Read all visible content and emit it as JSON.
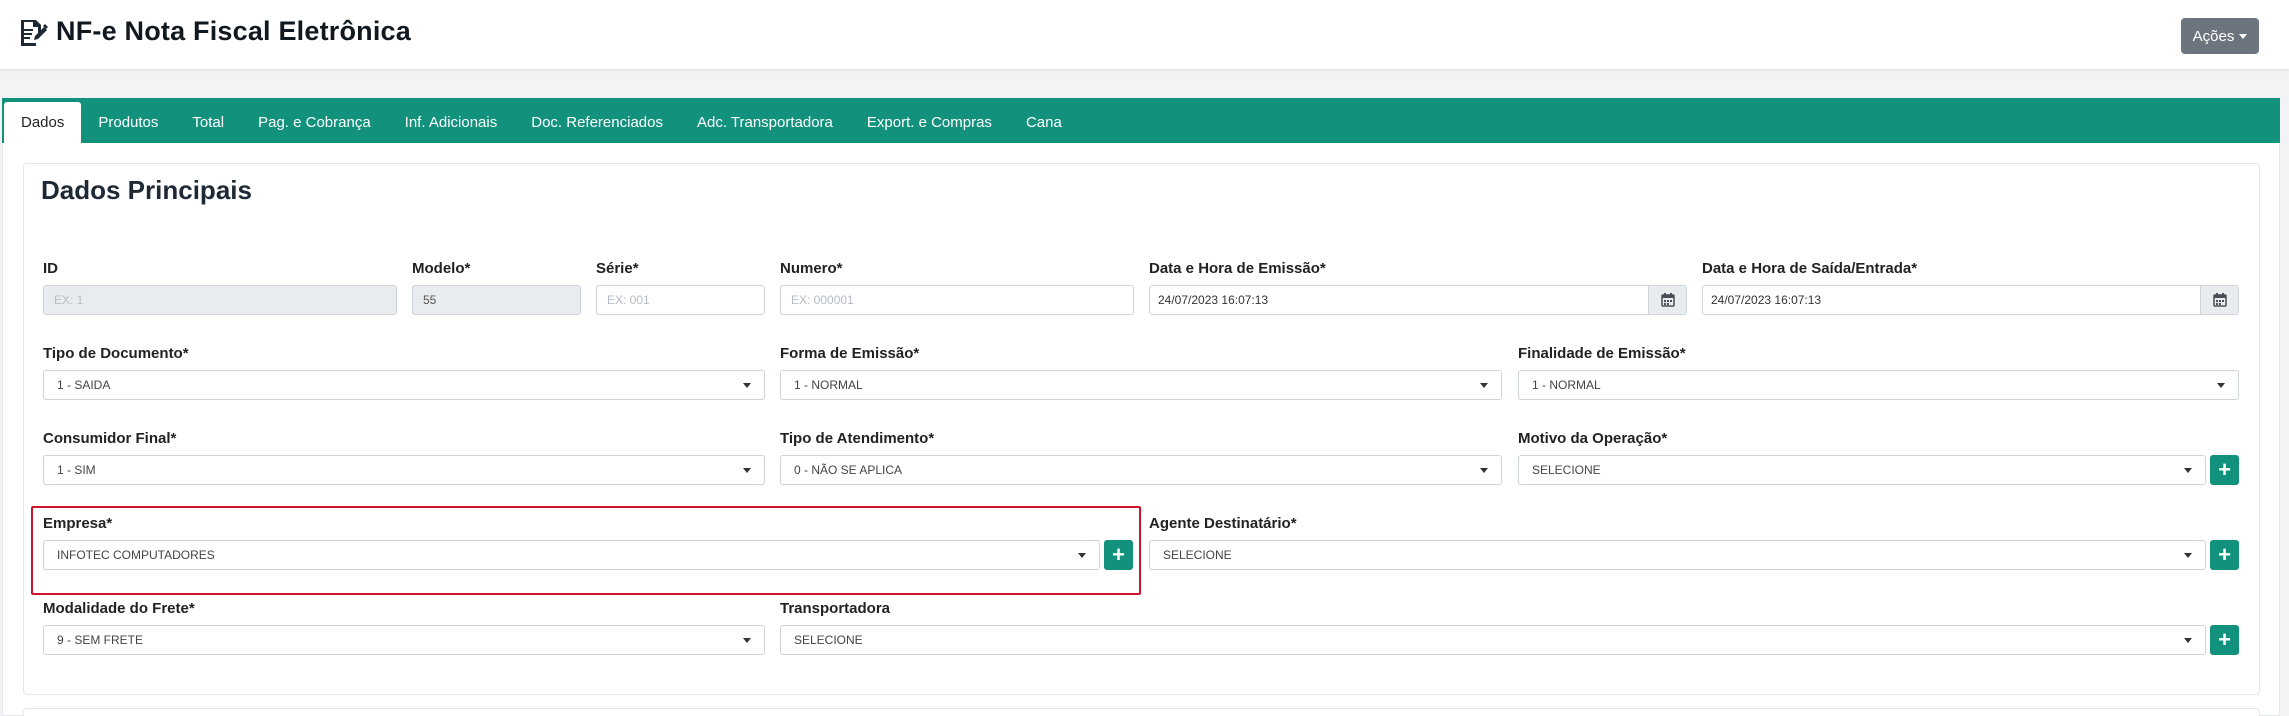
{
  "header": {
    "title": "NF-e Nota Fiscal Eletrônica",
    "title_icon": "document-edit-icon",
    "actions_label": "Ações"
  },
  "tabs": [
    {
      "label": "Dados",
      "active": true
    },
    {
      "label": "Produtos"
    },
    {
      "label": "Total"
    },
    {
      "label": "Pag. e Cobrança"
    },
    {
      "label": "Inf. Adicionais"
    },
    {
      "label": "Doc. Referenciados"
    },
    {
      "label": "Adc. Transportadora"
    },
    {
      "label": "Export. e Compras"
    },
    {
      "label": "Cana"
    }
  ],
  "section_title": "Dados Principais",
  "fields": {
    "id": {
      "label": "ID",
      "value": "",
      "placeholder": "EX: 1"
    },
    "modelo": {
      "label": "Modelo*",
      "value": "55"
    },
    "serie": {
      "label": "Série*",
      "value": "",
      "placeholder": "EX: 001"
    },
    "numero": {
      "label": "Numero*",
      "value": "",
      "placeholder": "EX: 000001"
    },
    "data_emissao": {
      "label": "Data e Hora de Emissão*",
      "value": "24/07/2023 16:07:13"
    },
    "data_saida": {
      "label": "Data e Hora de Saída/Entrada*",
      "value": "24/07/2023 16:07:13"
    },
    "tipo_documento": {
      "label": "Tipo de Documento*",
      "value": "1 - SAIDA"
    },
    "forma_emissao": {
      "label": "Forma de Emissão*",
      "value": "1 - NORMAL"
    },
    "finalidade_emissao": {
      "label": "Finalidade de Emissão*",
      "value": "1 - NORMAL"
    },
    "consumidor_final": {
      "label": "Consumidor Final*",
      "value": "1 - SIM"
    },
    "tipo_atendimento": {
      "label": "Tipo de Atendimento*",
      "value": "0 - NÃO SE APLICA"
    },
    "motivo_operacao": {
      "label": "Motivo da Operação*",
      "value": "SELECIONE"
    },
    "empresa": {
      "label": "Empresa*",
      "value": "INFOTEC COMPUTADORES"
    },
    "agente_destinatario": {
      "label": "Agente Destinatário*",
      "value": "SELECIONE"
    },
    "modalidade_frete": {
      "label": "Modalidade do Frete*",
      "value": "9 - SEM FRETE"
    },
    "transportadora": {
      "label": "Transportadora",
      "value": "SELECIONE"
    }
  },
  "colors": {
    "accent": "#12927c",
    "highlight": "#d0142c",
    "actions_button": "#6c757d"
  }
}
